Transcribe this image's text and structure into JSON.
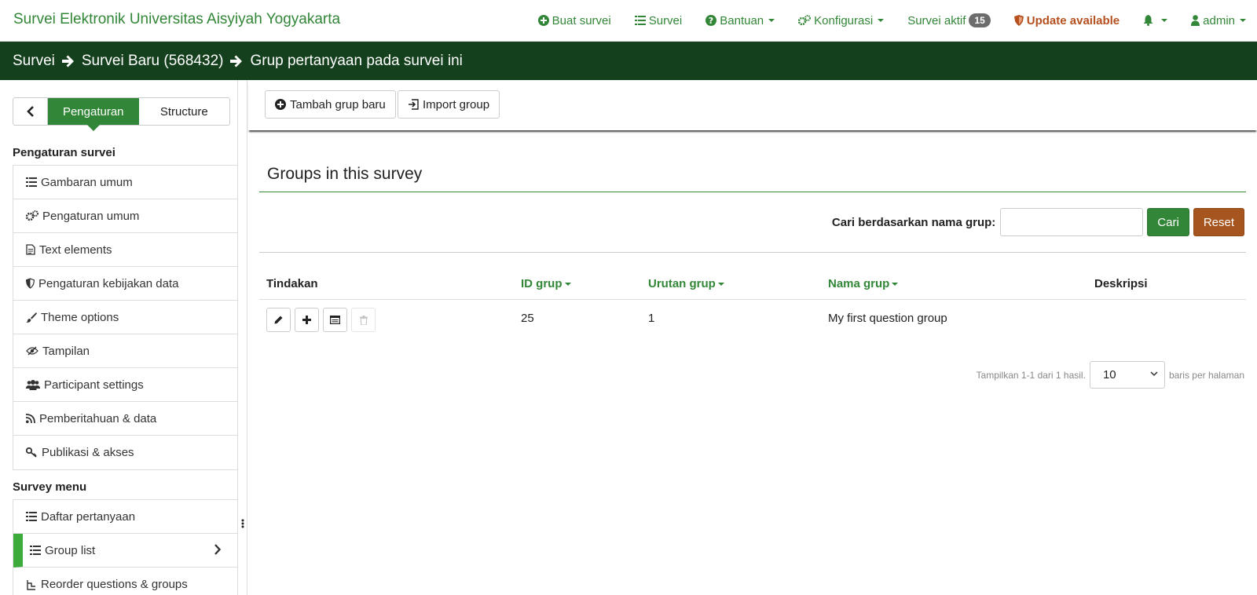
{
  "topbar": {
    "brand": "Survei Elektronik Universitas Aisyiyah Yogyakarta",
    "nav": {
      "create_survey": "Buat survei",
      "surveys": "Survei",
      "help": "Bantuan",
      "config": "Konfigurasi",
      "active_surveys": "Survei aktif",
      "active_count": "15",
      "update": "Update available",
      "user": "admin"
    }
  },
  "breadcrumb": {
    "items": [
      "Survei",
      "Survei Baru (568432)",
      "Grup pertanyaan pada survei ini"
    ]
  },
  "sidebar": {
    "tabs": {
      "settings": "Pengaturan",
      "structure": "Structure"
    },
    "settings_heading": "Pengaturan survei",
    "settings_items": [
      {
        "label": "Gambaran umum",
        "icon": "list-icon"
      },
      {
        "label": "Pengaturan umum",
        "icon": "cogs-icon"
      },
      {
        "label": "Text elements",
        "icon": "file-text-icon"
      },
      {
        "label": "Pengaturan kebijakan data",
        "icon": "shield-icon"
      },
      {
        "label": "Theme options",
        "icon": "brush-icon"
      },
      {
        "label": "Tampilan",
        "icon": "eye-slash-icon"
      },
      {
        "label": "Participant settings",
        "icon": "users-icon"
      },
      {
        "label": "Pemberitahuan & data",
        "icon": "rss-icon"
      },
      {
        "label": "Publikasi & akses",
        "icon": "key-icon"
      }
    ],
    "menu_heading": "Survey menu",
    "menu_items": [
      {
        "label": "Daftar pertanyaan",
        "icon": "list-icon"
      },
      {
        "label": "Group list",
        "icon": "list-icon"
      },
      {
        "label": "Reorder questions & groups",
        "icon": "reorder-icon"
      }
    ]
  },
  "toolbar": {
    "add_group": "Tambah grup baru",
    "import_group": "Import group"
  },
  "main": {
    "title": "Groups in this survey",
    "search_label": "Cari berdasarkan nama grup:",
    "search_value": "",
    "search_button": "Cari",
    "reset_button": "Reset"
  },
  "table": {
    "headers": {
      "actions": "Tindakan",
      "id": "ID grup",
      "order": "Urutan grup",
      "name": "Nama grup",
      "description": "Deskripsi"
    },
    "rows": [
      {
        "id": "25",
        "order": "1",
        "name": "My first question group",
        "description": ""
      }
    ]
  },
  "pager": {
    "summary": "Tampilkan 1-1 dari 1 hasil.",
    "page_size": "10",
    "suffix": "baris per halaman"
  },
  "colors": {
    "brand_green": "#328637",
    "dark_green": "#14401d",
    "reset_brown": "#a6551e",
    "update_orange": "#b5501e"
  }
}
